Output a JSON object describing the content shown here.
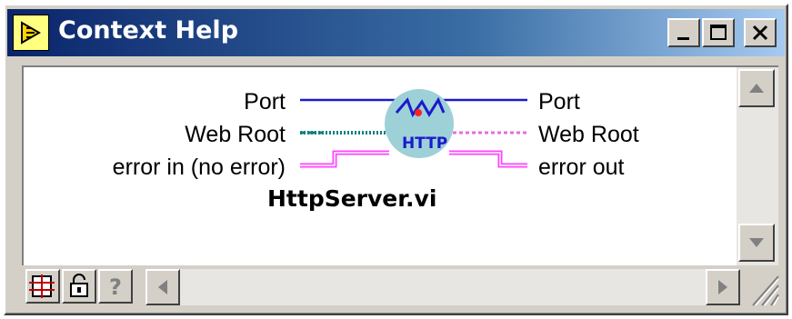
{
  "window": {
    "title": "Context Help"
  },
  "connector": {
    "vi_name": "HttpServer.vi",
    "icon_text": "HTTP",
    "inputs": [
      "Port",
      "Web Root",
      "error in (no error)"
    ],
    "outputs": [
      "Port",
      "Web Root",
      "error out"
    ]
  },
  "colors": {
    "titlebar": "#0a246a",
    "wire_int": "#1a1acc",
    "wire_path": "#0a8080",
    "wire_path_out": "#e070e0",
    "wire_error": "#ff44ff",
    "icon_bg": "#9ed0d8"
  },
  "toolbar": {
    "buttons": [
      "show-optional-terminals-icon",
      "lock-icon",
      "help-icon"
    ]
  }
}
